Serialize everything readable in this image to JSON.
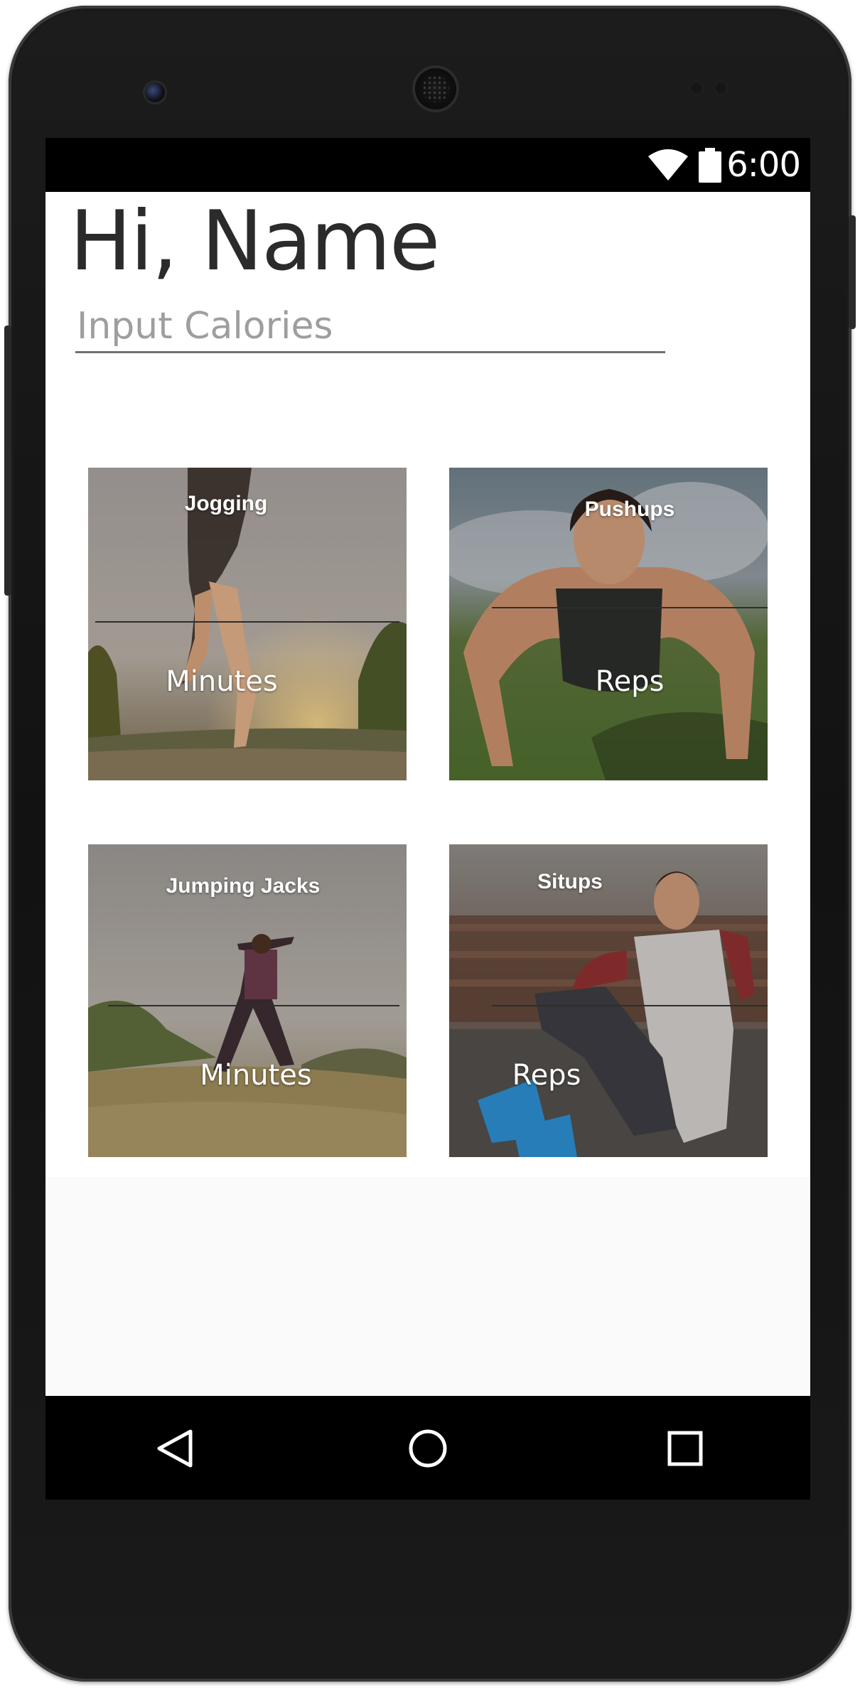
{
  "status_bar": {
    "time": "6:00",
    "icons": [
      "wifi-icon",
      "battery-icon"
    ]
  },
  "greeting": "Hi, Name",
  "calories_input": {
    "placeholder": "Input Calories",
    "value": ""
  },
  "exercises": [
    {
      "title": "Jogging",
      "unit": "Minutes",
      "image": "runner-image"
    },
    {
      "title": "Pushups",
      "unit": "Reps",
      "image": "pushup-image"
    },
    {
      "title": "Jumping Jacks",
      "unit": "Minutes",
      "image": "jumping-jack-image"
    },
    {
      "title": "Situps",
      "unit": "Reps",
      "image": "situp-image"
    }
  ],
  "nav_bar": {
    "icons": [
      "back-icon",
      "home-icon",
      "recents-icon"
    ]
  },
  "colors": {
    "text_primary": "#2b2b2b",
    "placeholder": "#9e9e9e",
    "underline": "#707070",
    "system_bar": "#000000"
  }
}
